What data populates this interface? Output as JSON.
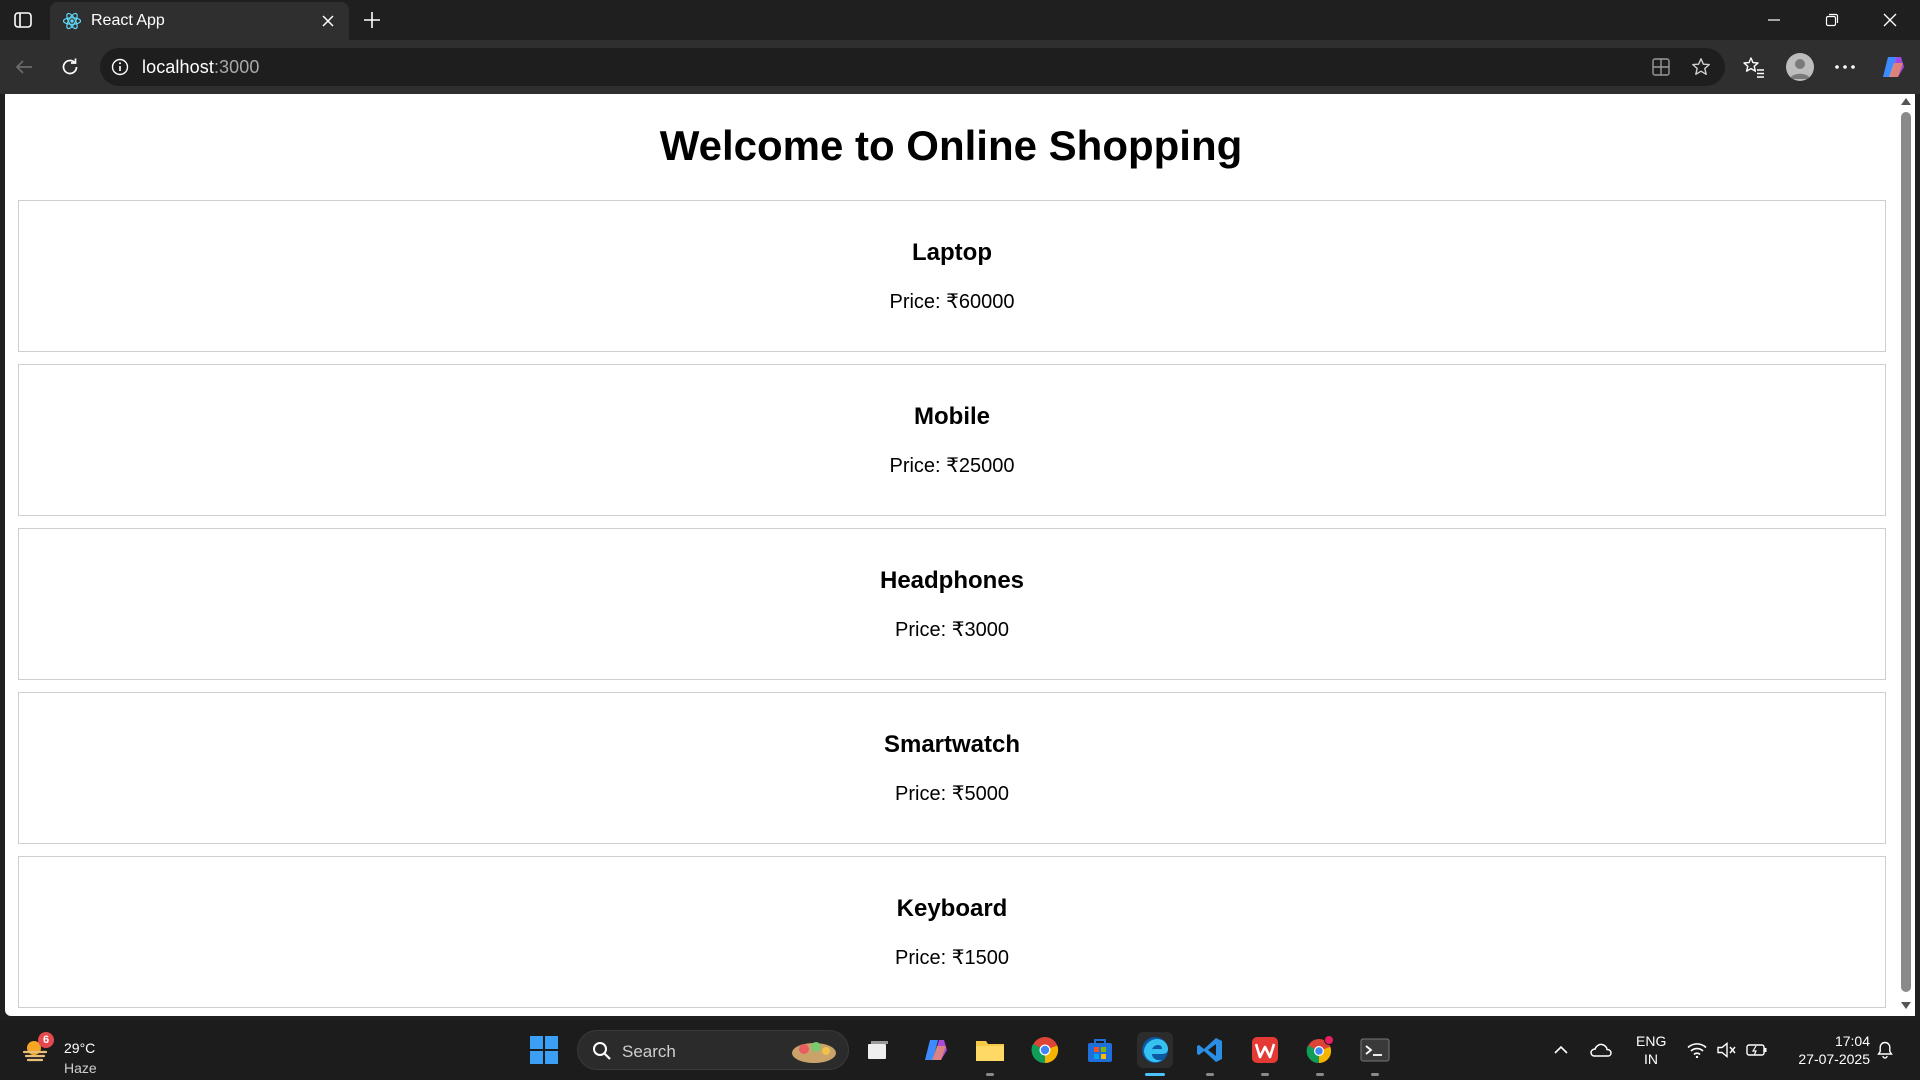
{
  "browser": {
    "tab": {
      "title": "React App"
    },
    "address": {
      "host": "localhost",
      "port": ":3000"
    }
  },
  "page": {
    "title": "Welcome to Online Shopping",
    "products": [
      {
        "name": "Laptop",
        "price": "Price: ₹60000"
      },
      {
        "name": "Mobile",
        "price": "Price: ₹25000"
      },
      {
        "name": "Headphones",
        "price": "Price: ₹3000"
      },
      {
        "name": "Smartwatch",
        "price": "Price: ₹5000"
      },
      {
        "name": "Keyboard",
        "price": "Price: ₹1500"
      }
    ]
  },
  "taskbar": {
    "weather": {
      "temp": "29°C",
      "condition": "Haze",
      "badge": "6"
    },
    "search_label": "Search",
    "apps": [
      "start-icon",
      "task-view-icon",
      "copilot-icon",
      "file-explorer-icon",
      "chrome-icon",
      "store-icon",
      "edge-icon",
      "vscode-icon",
      "wps-icon",
      "chrome-profile-icon",
      "terminal-icon"
    ],
    "tray": {
      "lang_line1": "ENG",
      "lang_line2": "IN",
      "time": "17:04",
      "date": "27-07-2025"
    }
  },
  "colors": {
    "accent": "#4cc2ff",
    "taskbar_bg": "#1c1c1c",
    "chrome_bg": "#2f2f2f"
  }
}
